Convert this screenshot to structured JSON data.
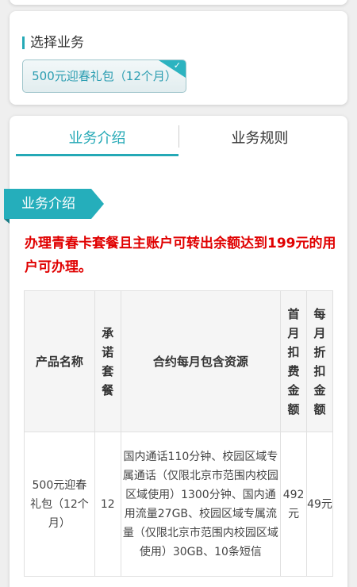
{
  "select_section": {
    "title": "选择业务",
    "selected_package": "500元迎春礼包（12个月）"
  },
  "tabs": [
    {
      "label": "业务介绍",
      "active": true
    },
    {
      "label": "业务规则",
      "active": false
    }
  ],
  "intro": {
    "ribbon_label": "业务介绍",
    "notice": "办理青春卡套餐且主账户可转出余额达到199元的用户可办理。",
    "table": {
      "headers": [
        "产品名称",
        "承诺套餐",
        "合约每月包含资源",
        "首月扣费金额",
        "每月折扣金额"
      ],
      "rows": [
        {
          "name": "500元迎春礼包（12个月）",
          "months": "12",
          "resources": "国内通话110分钟、校园区域专属通话（仅限北京市范围内校园区域使用）1300分钟、国内通用流量27GB、校园区域专属流量（仅限北京市范围内校园区域使用）30GB、10条短信",
          "first_month_fee": "492元",
          "monthly_discount": "49元"
        }
      ]
    }
  },
  "colors": {
    "accent": "#25a9b6",
    "notice_red": "#e00000",
    "background": "#efefef"
  }
}
